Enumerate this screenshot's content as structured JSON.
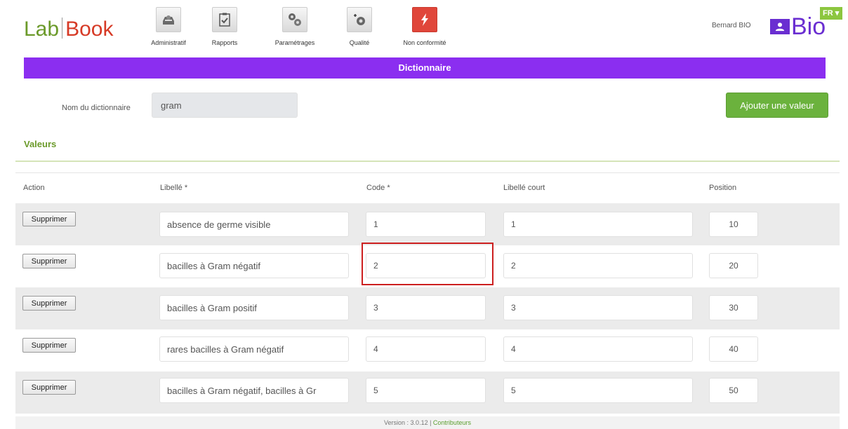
{
  "header": {
    "logo": {
      "lab": "Lab",
      "book": "Book"
    },
    "nav": [
      {
        "label": "Administratif",
        "icon": "inbox-icon"
      },
      {
        "label": "Rapports",
        "icon": "clipboard-check-icon"
      },
      {
        "label": "Paramétrages",
        "icon": "gears-icon"
      },
      {
        "label": "Qualité",
        "icon": "quality-gear-icon"
      },
      {
        "label": "Non conformité",
        "icon": "lightning-icon"
      }
    ],
    "user": "Bernard BIO",
    "bio_logo_text": "Bio",
    "lang": "FR ▾"
  },
  "banner": {
    "title": "Dictionnaire"
  },
  "form": {
    "name_label": "Nom du dictionnaire",
    "name_value": "gram",
    "add_button": "Ajouter une valeur"
  },
  "section": {
    "title": "Valeurs"
  },
  "table": {
    "headers": [
      "Action",
      "Libellé *",
      "Code *",
      "Libellé court",
      "Position"
    ],
    "delete_label": "Supprimer",
    "rows": [
      {
        "libelle": "absence de germe visible",
        "code": "1",
        "short": "1",
        "position": "10"
      },
      {
        "libelle": "bacilles à Gram négatif",
        "code": "2",
        "short": "2",
        "position": "20"
      },
      {
        "libelle": "bacilles à Gram positif",
        "code": "3",
        "short": "3",
        "position": "30"
      },
      {
        "libelle": "rares bacilles à Gram négatif",
        "code": "4",
        "short": "4",
        "position": "40"
      },
      {
        "libelle": "bacilles à Gram négatif, bacilles à Gr",
        "code": "5",
        "short": "5",
        "position": "50"
      }
    ]
  },
  "footer": {
    "version": "Version : 3.0.12 | ",
    "link": "Contributeurs"
  },
  "colors": {
    "banner": "#8b2ef0",
    "accent_green": "#6bb23d",
    "highlight": "#cc1f1f",
    "bio_purple": "#6a2ed1"
  }
}
